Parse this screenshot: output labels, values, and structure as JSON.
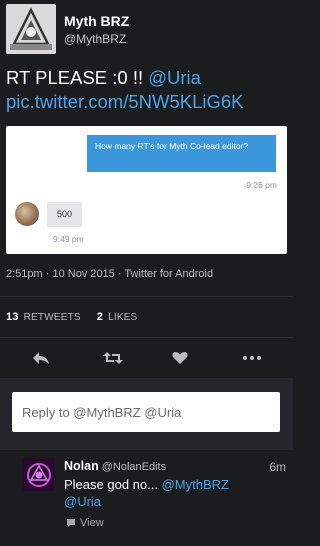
{
  "tweet": {
    "display_name": "Myth BRZ",
    "handle": "@MythBRZ",
    "text_plain": "RT PLEASE :0 !! ",
    "mention": "@Uria",
    "link": "pic.twitter.com/5NW5KLiG6K",
    "timestamp": "2:51pm · 10 Nov 2015 · Twitter for Android",
    "retweets_count": "13",
    "retweets_label": "RETWEETS",
    "likes_count": "2",
    "likes_label": "LIKES"
  },
  "media": {
    "outgoing_message": "How many RT's for Myth Co-lead editor?",
    "outgoing_time": "9:26 pm",
    "incoming_message": "500",
    "incoming_time": "9:49 pm"
  },
  "actions": {
    "reply_icon": "reply-icon",
    "retweet_icon": "retweet-icon",
    "like_icon": "heart-icon",
    "more_icon": "more-icon",
    "icon_color": "#bdbdbd"
  },
  "reply_input": {
    "placeholder": "Reply to @MythBRZ @Uria"
  },
  "reply": {
    "display_name": "Nolan",
    "handle": "@NolanEdits",
    "time": "6m",
    "text_plain": "Please god no... ",
    "mention1": "@MythBRZ",
    "mention2": "@Uria",
    "view_label": "View"
  },
  "colors": {
    "background": "#1b1c1e",
    "link": "#4ea3e8",
    "bubble_blue": "#3b97db"
  }
}
